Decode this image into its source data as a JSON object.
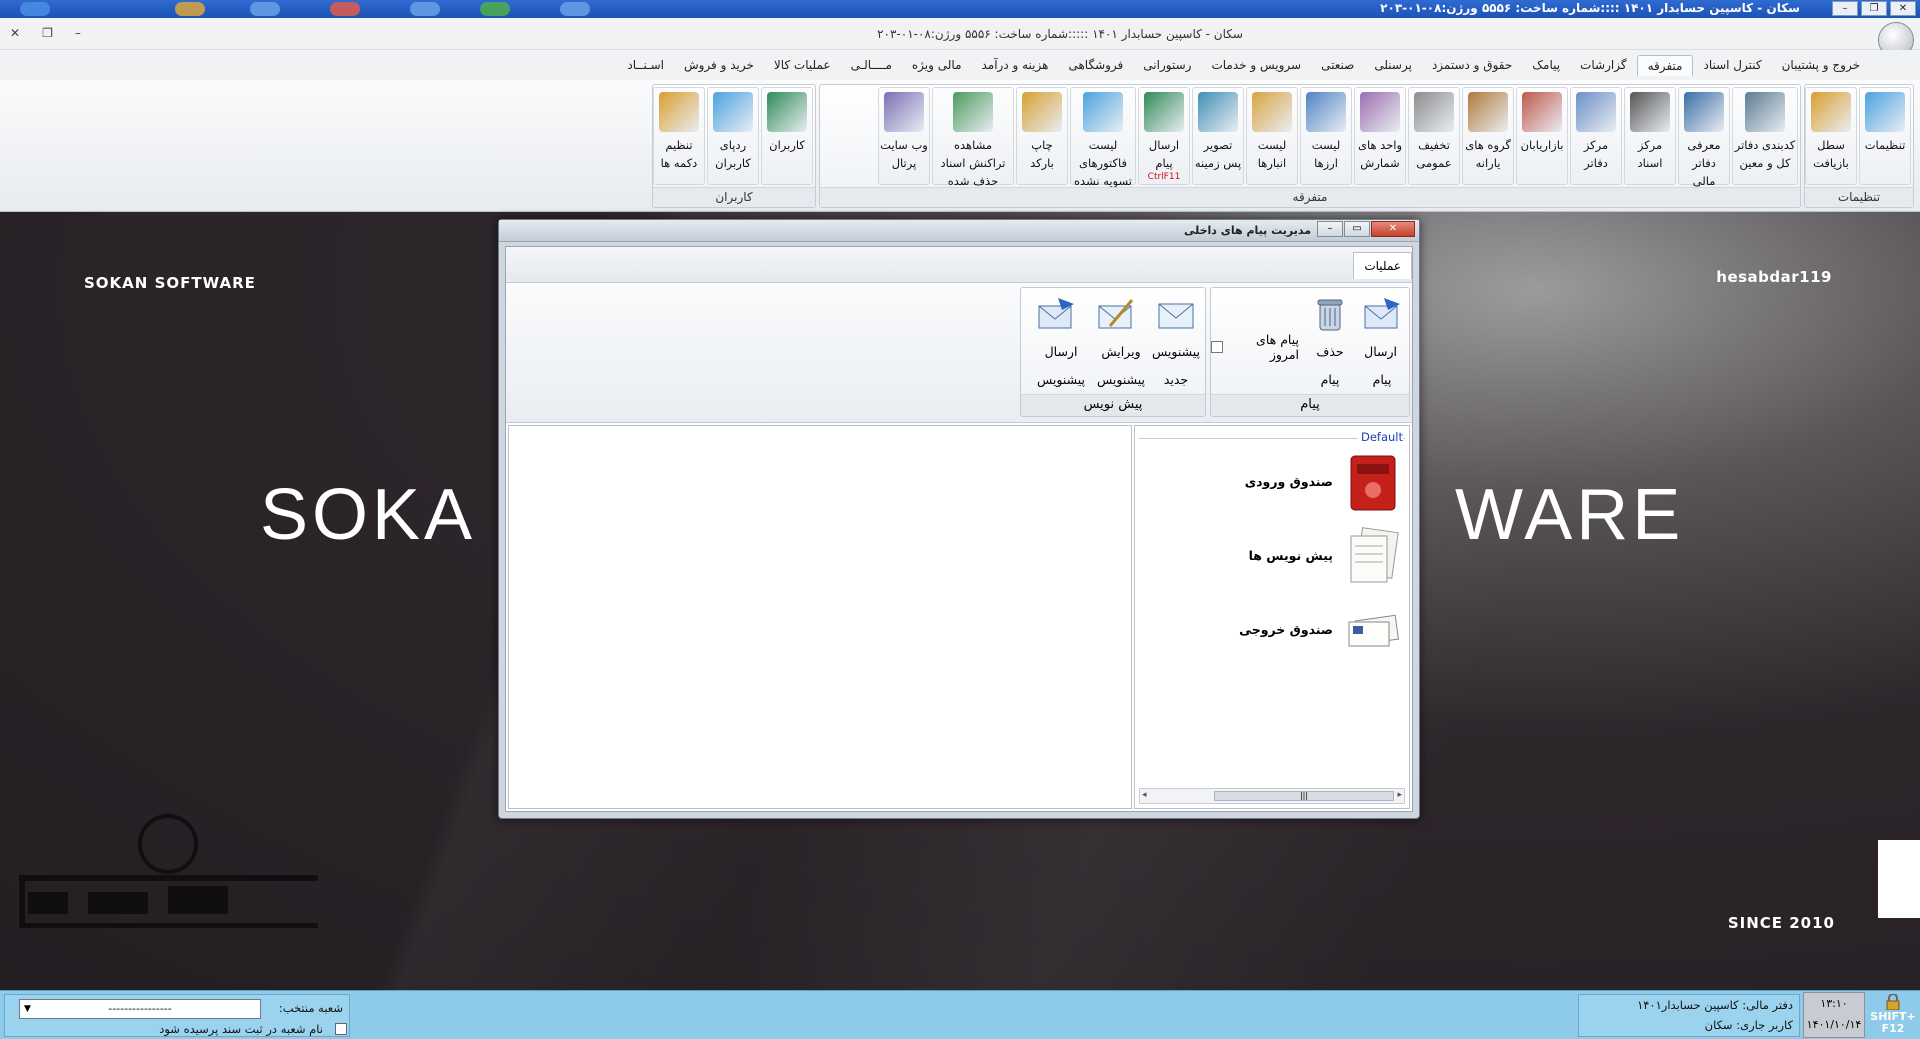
{
  "os_bar": {
    "title": "سکان - کاسپین حسابدار ۱۴۰۱ ::::شماره ساخت: ۵۵۵۶   ورژن:۰۸-۰۱-۲۰۳"
  },
  "app": {
    "title": "سکان - کاسپین حسابدار ۱۴۰۱ :::::شماره ساخت: ۵۵۵۶   ورژن:۰۸-۰۱-۲۰۳"
  },
  "menu_tabs": [
    "اسـنــاد",
    "خرید و فروش",
    "عملیات کالا",
    "مــــالـی",
    "مالی ویژه",
    "هزینه و درآمد",
    "فروشگاهی",
    "رستورانی",
    "سرویس و خدمات",
    "صنعتی",
    "پرسنلی",
    "حقوق و دستمزد",
    "پیامک",
    "گزارشات",
    "متفرقه",
    "کنترل اسناد",
    "خروج و پشتیبان"
  ],
  "ribbon": {
    "group_settings": "تنظیمات",
    "group_misc": "متفرقه",
    "group_users": "کاربران",
    "settings_buttons": [
      {
        "label": "تنظیمات",
        "icon": "wrench-icon"
      },
      {
        "label": "سطل بازیافت",
        "icon": "recycle-bin-icon"
      }
    ],
    "misc_buttons": [
      {
        "label": "کدبندی دفاتر کل و معین",
        "icon": "books-icon"
      },
      {
        "label": "معرفی دفاتر مالی",
        "icon": "ledger-icon"
      },
      {
        "label": "مرکز اسناد",
        "icon": "house-doc-icon"
      },
      {
        "label": "مرکز دفاتر",
        "icon": "house-chart-icon"
      },
      {
        "label": "بازاریابان",
        "icon": "marketers-icon"
      },
      {
        "label": "گروه های یارانه",
        "icon": "group-icon"
      },
      {
        "label": "تخفیف عمومی",
        "icon": "boxes-icon"
      },
      {
        "label": "واحد های شمارش",
        "icon": "units-icon"
      },
      {
        "label": "لیست ارزها",
        "icon": "currency-icon"
      },
      {
        "label": "لیست انبارها",
        "icon": "warehouse-icon"
      },
      {
        "label": "تصویر پس زمینه",
        "icon": "camera-icon"
      },
      {
        "label": "ارسال پیام",
        "sub": "CtrlF11",
        "icon": "sms-icon"
      },
      {
        "label": "لیست فاکتورهای تسویه نشده",
        "icon": "invoice-icon"
      },
      {
        "label": "چاپ بارکد",
        "icon": "barcode-icon"
      },
      {
        "label": "مشاهده تراکنش اسناد حذف شده",
        "icon": "notepad-icon"
      },
      {
        "label": "وب سایت پرتال",
        "icon": "portal-icon"
      }
    ],
    "users_buttons": [
      {
        "label": "کاربران",
        "icon": "users-money-icon"
      },
      {
        "label": "ردپای کاربران",
        "icon": "footprint-icon"
      },
      {
        "label": "تنظیم دکمه ها",
        "icon": "footprint-settings-icon"
      }
    ]
  },
  "splash": {
    "company": "SOKAN SOFTWARE",
    "user": "hesabdar119",
    "since": "SINCE 2010",
    "big_left": "SOKA",
    "big_right": "WARE"
  },
  "dialog": {
    "title": "مدیریت پیام های داخلی",
    "tab": "عملیات",
    "group_message": "پیام",
    "group_draft": "پیش نویس",
    "send_message": "ارسال پیام",
    "delete_message": "حذف پیام",
    "today_messages": "پیام های امروز",
    "new_draft": "پیشنویس جدید",
    "edit_draft": "ویرایش پیشنویس",
    "send_draft": "ارسال پیشنویس",
    "default_label": "Default",
    "folders": [
      "صندوق ورودی",
      "پیش نویس ها",
      "صندوق خروجی"
    ],
    "scroll_thumb": "|||"
  },
  "status": {
    "branch_label": "شعبه منتخب:",
    "branch_value": "----------------",
    "ask_branch": "نام شعبه در ثبت سند پرسیده شود",
    "fiscal": "دفتر مالی: کاسپین حسابدار۱۴۰۱",
    "current_user": "کاربر جاری: سکان",
    "time": "۱۳:۱۰",
    "date": "۱۴۰۱/۱۰/۱۴",
    "shortcut": "SHIFT+ F12"
  }
}
